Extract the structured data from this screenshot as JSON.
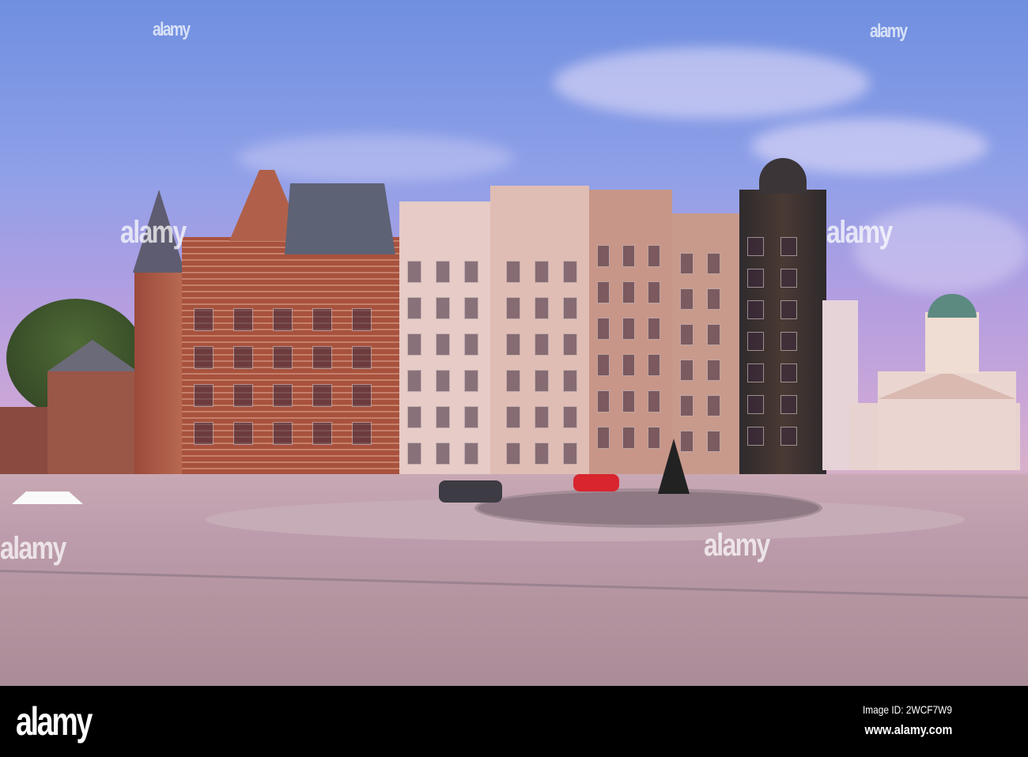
{
  "watermark": {
    "text": "alamy"
  },
  "footer": {
    "logo": "alamy",
    "image_id": "Image ID: 2WCF7W9",
    "url": "www.alamy.com"
  },
  "colors": {
    "sky_top": "#6f8fe0",
    "sky_bottom": "#d8b0cc",
    "brick": "#a8523e",
    "stone": "#e4c7c0",
    "ground": "#bc9cac"
  }
}
